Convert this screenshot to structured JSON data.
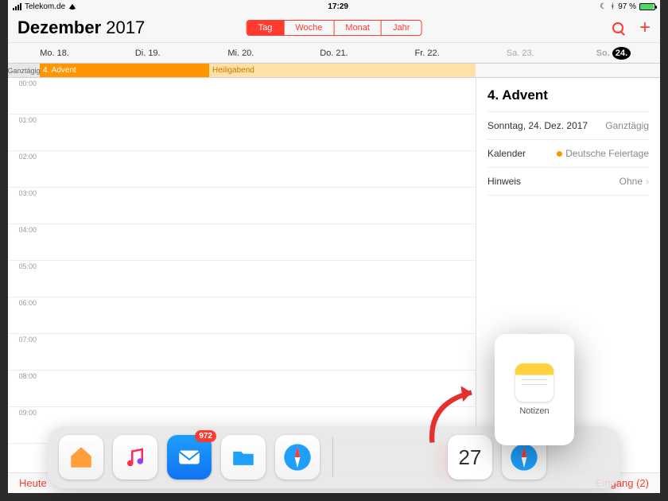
{
  "status": {
    "carrier": "Telekom.de",
    "time": "17:29",
    "battery": "97 %"
  },
  "header": {
    "month": "Dezember",
    "year": "2017",
    "seg": [
      "Tag",
      "Woche",
      "Monat",
      "Jahr"
    ],
    "active": 0
  },
  "days": [
    {
      "label": "Mo. 18."
    },
    {
      "label": "Di. 19."
    },
    {
      "label": "Mi. 20."
    },
    {
      "label": "Do. 21."
    },
    {
      "label": "Fr. 22."
    },
    {
      "label": "Sa. 23.",
      "weekend": true
    },
    {
      "label": "So.",
      "num": "24.",
      "weekend": true,
      "selected": true
    }
  ],
  "allday": {
    "label": "Ganztägig",
    "ev1": "4. Advent",
    "ev2": "Heiligabend"
  },
  "hours": [
    "00:00",
    "01:00",
    "02:00",
    "03:00",
    "04:00",
    "05:00",
    "06:00",
    "07:00",
    "08:00",
    "09:00"
  ],
  "detail": {
    "title": "4. Advent",
    "dateline": "Sonntag, 24. Dez. 2017",
    "allday": "Ganztägig",
    "cal_label": "Kalender",
    "cal_value": "Deutsche Feiertage",
    "alert_label": "Hinweis",
    "alert_value": "Ohne"
  },
  "footer": {
    "today": "Heute",
    "inbox": "Eingang (2)"
  },
  "dock": {
    "mail_badge": "972",
    "cal_day": "27",
    "notes_label": "Notizen"
  }
}
